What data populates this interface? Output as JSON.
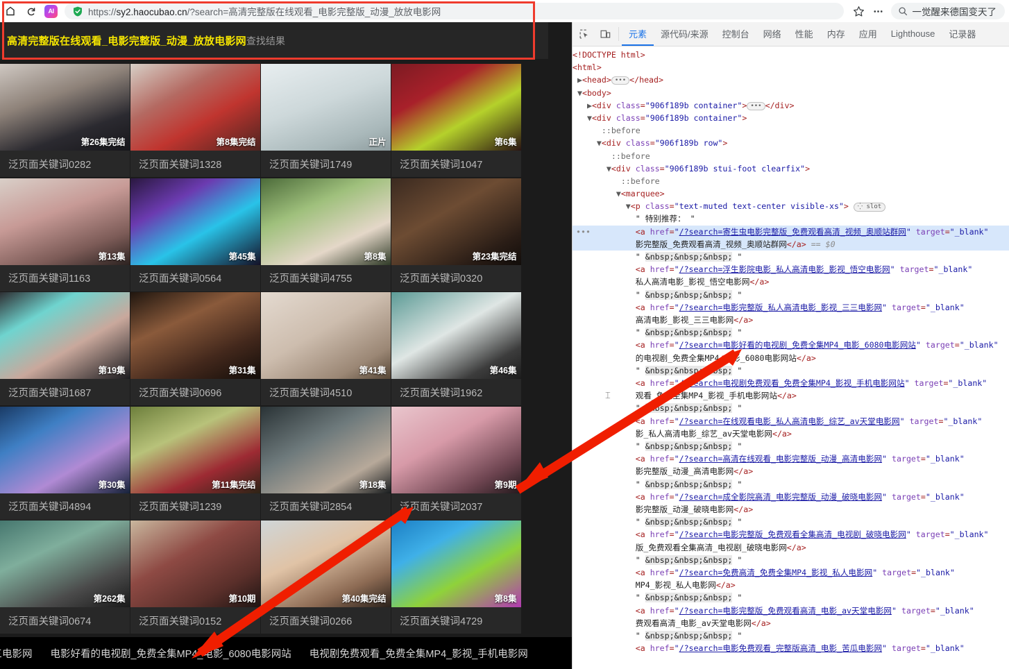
{
  "browser": {
    "home_icon": "home-icon",
    "reload_icon": "reload-icon",
    "ai_badge_label": "AI",
    "security_icon": "shield-lock-icon",
    "url_scheme": "https://",
    "url_host": "sy2.haocubao.cn",
    "url_path": "/?search=高清完整版在线观看_电影完整版_动漫_放放电影网",
    "url_full": "https://sy2.haocubao.cn/?search=高清完整版在线观看_电影完整版_动漫_放放电影网",
    "bookmark_icon": "star-icon",
    "more_icon": "more-horizontal-icon",
    "search_icon": "search-icon",
    "search_suggestion": "一觉醒来德国变天了"
  },
  "page": {
    "title_keyword": "高清完整版在线观看_电影完整版_动漫_放放电影网",
    "title_suffix": "查找结果",
    "cards": [
      {
        "badge": "第26集完结",
        "title": "泛页面关键词0282"
      },
      {
        "badge": "第8集完结",
        "title": "泛页面关键词1328"
      },
      {
        "badge": "正片",
        "title": "泛页面关键词1749"
      },
      {
        "badge": "第6集",
        "title": "泛页面关键词1047"
      },
      {
        "badge": "第13集",
        "title": "泛页面关键词1163"
      },
      {
        "badge": "第45集",
        "title": "泛页面关键词0564"
      },
      {
        "badge": "第8集",
        "title": "泛页面关键词4755"
      },
      {
        "badge": "第23集完结",
        "title": "泛页面关键词0320"
      },
      {
        "badge": "第19集",
        "title": "泛页面关键词1687"
      },
      {
        "badge": "第31集",
        "title": "泛页面关键词0696"
      },
      {
        "badge": "第41集",
        "title": "泛页面关键词4510"
      },
      {
        "badge": "第46集",
        "title": "泛页面关键词1962"
      },
      {
        "badge": "第30集",
        "title": "泛页面关键词4894"
      },
      {
        "badge": "第11集完结",
        "title": "泛页面关键词1239"
      },
      {
        "badge": "第18集",
        "title": "泛页面关键词2854"
      },
      {
        "badge": "第9期",
        "title": "泛页面关键词2037"
      },
      {
        "badge": "第262集",
        "title": "泛页面关键词0674"
      },
      {
        "badge": "第10期",
        "title": "泛页面关键词0152"
      },
      {
        "badge": "第40集完结",
        "title": "泛页面关键词0266"
      },
      {
        "badge": "第8集",
        "title": "泛页面关键词4729"
      }
    ],
    "footer_links": [
      "三三电影网",
      "电影好看的电视剧_免费全集MP4_电影_6080电影网站",
      "电视剧免费观看_免费全集MP4_影视_手机电影网"
    ]
  },
  "devtools": {
    "inspect_icon": "inspect-element-icon",
    "device_icon": "device-toolbar-icon",
    "tabs": [
      {
        "label": "元素",
        "active": true
      },
      {
        "label": "源代码/来源",
        "active": false
      },
      {
        "label": "控制台",
        "active": false
      },
      {
        "label": "网络",
        "active": false
      },
      {
        "label": "性能",
        "active": false
      },
      {
        "label": "内存",
        "active": false
      },
      {
        "label": "应用",
        "active": false
      },
      {
        "label": "Lighthouse",
        "active": false
      },
      {
        "label": "记录器",
        "active": false
      }
    ],
    "dom": {
      "doctype": "<!DOCTYPE html>",
      "html_tag": "<html>",
      "head_tag_open": "<head>",
      "head_tag_close": "</head>",
      "body_tag": "<body>",
      "div_class_1": "906f189b container",
      "div_class_2": "906f189b container",
      "div_class_row": "906f189b row",
      "div_class_foot": "906f189b stui-foot clearfix",
      "marquee_tag": "<marquee>",
      "p_class": "text-muted text-center visible-xs",
      "slot_chip": "slot",
      "before_label": "::before",
      "recommend_text": " 特别推荐： ",
      "nbsp_text": " &nbsp;&nbsp;&nbsp; ",
      "selected_marker": "== $0",
      "target_attr": "target",
      "target_value": "_blank",
      "href_attr": "href",
      "links": [
        {
          "href": "/?search=寄生虫电影完整版_免费观看高清_视频_奥顺站群网",
          "text_tail": "影完整版_免费观看高清_视频_奥顺站群网",
          "selected": true
        },
        {
          "href": "/?search=浮生影院电影_私人高清电影_影视_悟空电影网",
          "text_tail": "私人高清电影_影视_悟空电影网",
          "selected": false
        },
        {
          "href": "/?search=电影完整版_私人高清电影_影视_三三电影网",
          "text_tail": "高清电影_影视_三三电影网",
          "selected": false
        },
        {
          "href": "/?search=电影好看的电视剧_免费全集MP4_电影_6080电影网站",
          "text_tail": "的电视剧_免费全集MP4_电影_6080电影网站",
          "selected": false
        },
        {
          "href": "/?search=电视剧免费观看_免费全集MP4_影视_手机电影网站",
          "text_tail": "观看_免费全集MP4_影视_手机电影网站",
          "selected": false
        },
        {
          "href": "/?search=在线观看电影_私人高清电影_综艺_av天堂电影网",
          "text_tail": "影_私人高清电影_综艺_av天堂电影网",
          "selected": false
        },
        {
          "href": "/?search=高清在线观看_电影完整版_动漫_高清电影网",
          "text_tail": "影完整版_动漫_高清电影网",
          "selected": false
        },
        {
          "href": "/?search=成全影院高清_电影完整版_动漫_破晓电影网",
          "text_tail": "影完整版_动漫_破晓电影网",
          "selected": false
        },
        {
          "href": "/?search=电影完整版_免费观看全集高清_电视剧_破晓电影网",
          "text_tail": "版_免费观看全集高清_电视剧_破晓电影网",
          "selected": false
        },
        {
          "href": "/?search=免费高清_免费全集MP4_影视_私人电影网",
          "text_tail": "MP4_影视_私人电影网",
          "selected": false
        },
        {
          "href": "/?search=电影完整版_免费观看高清_电影_av天堂电影网",
          "text_tail": "费观看高清_电影_av天堂电影网",
          "selected": false
        },
        {
          "href": "/?search=电影免费观看_完整版高清_电影_苦瓜电影网",
          "text_tail": "",
          "selected": false
        }
      ]
    }
  },
  "annotations": {
    "highlight_box_color": "#ef3b2d",
    "arrow_color": "#f01e00"
  }
}
